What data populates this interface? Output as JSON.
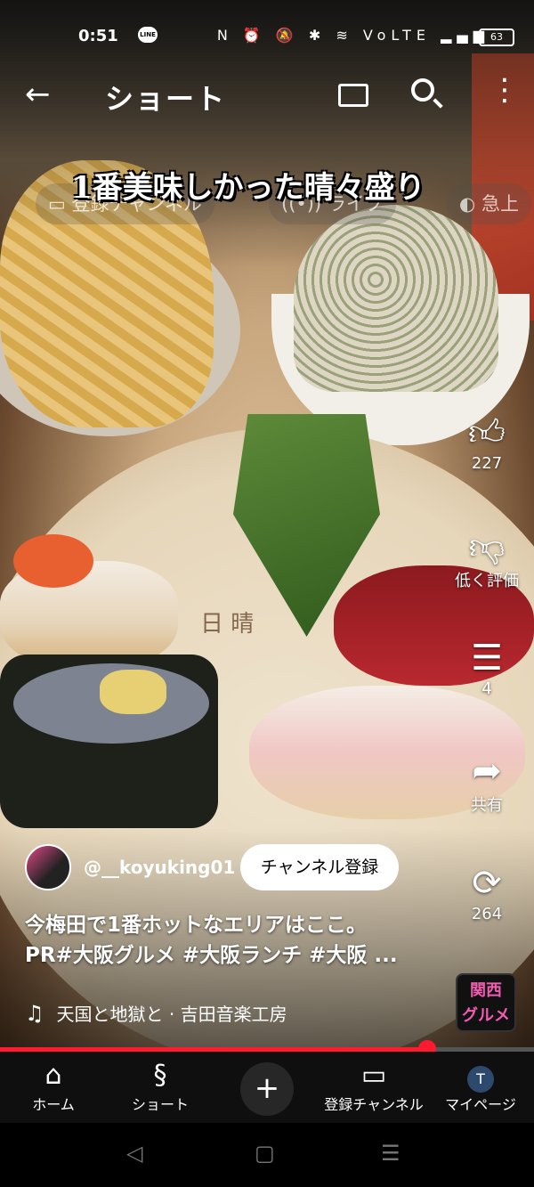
{
  "status_bar": {
    "time": "0:51",
    "line_label": "LINE",
    "icons": "N ⏰ 🔕 ✱ ≋ VoLTE ▂▄▆",
    "battery": "63"
  },
  "top_bar": {
    "title": "ショート"
  },
  "video": {
    "overlay_title": "1番美味しかった晴々盛り"
  },
  "chips": [
    "登録チャンネル",
    "ライブ",
    "急上"
  ],
  "actions": {
    "like": "227",
    "dislike": "低く評価",
    "comments": "4",
    "share": "共有",
    "remix": "264"
  },
  "channel": {
    "handle": "@__koyuking01",
    "subscribe": "チャンネル登録"
  },
  "caption": {
    "line1": "今梅田で1番ホットなエリアはここ。",
    "line2": "PR#大阪グルメ #大阪ランチ #大阪 ..."
  },
  "music": "天国と地獄と · 吉田音楽工房",
  "badge": {
    "line1": "関西",
    "line2": "グルメ"
  },
  "progress": {
    "fraction": 0.8
  },
  "nav": {
    "home": "ホーム",
    "shorts": "ショート",
    "subscriptions": "登録チャンネル",
    "mypage": "マイページ",
    "avatar_letter": "T"
  }
}
